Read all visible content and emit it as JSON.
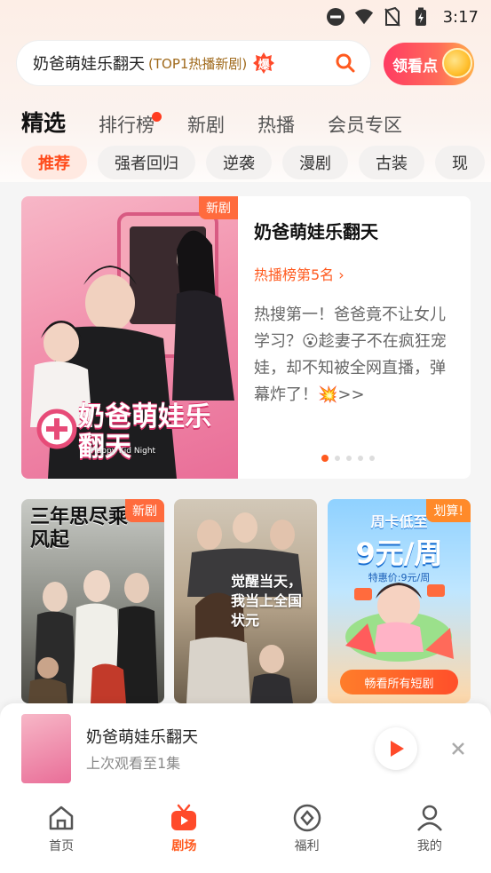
{
  "status_bar": {
    "time": "3:17"
  },
  "search": {
    "query": "奶爸萌娃乐翻天",
    "hint": "(TOP1热播新剧)",
    "hot_badge": "爆"
  },
  "reward_button": {
    "label": "领看点"
  },
  "tabs": [
    {
      "label": "精选",
      "active": true
    },
    {
      "label": "排行榜",
      "has_dot": true
    },
    {
      "label": "新剧"
    },
    {
      "label": "热播"
    },
    {
      "label": "会员专区"
    }
  ],
  "chips": [
    "推荐",
    "强者回归",
    "逆袭",
    "漫剧",
    "古装",
    "现"
  ],
  "featured": {
    "tag": "新剧",
    "title": "奶爸萌娃乐翻天",
    "rank": "热播榜第5名 ›",
    "description": "热搜第一！爸爸竟不让女儿学习？😮趁妻子不在疯狂宠娃，却不知被全网直播，弹幕炸了！💥>>",
    "poster_text": "奶爸萌娃乐翻天",
    "poster_subtext": "Happy Kid Night",
    "carousel_count": 5,
    "carousel_index": 0
  },
  "grid": [
    {
      "tag": "新剧",
      "poster_text": "三年思尽乘风起"
    },
    {
      "tag": "",
      "poster_text": "觉醒当天，我当上全国状元"
    },
    {
      "tag": "划算!",
      "promo_title": "周卡低至",
      "promo_price": "9元/周",
      "promo_sub": "特惠价:9元/周",
      "promo_button": "畅看所有短剧"
    }
  ],
  "mini_player": {
    "title": "奶爸萌娃乐翻天",
    "progress_text": "上次观看至1集"
  },
  "bottom_nav": [
    {
      "label": "首页",
      "icon": "home-icon"
    },
    {
      "label": "剧场",
      "icon": "theater-icon",
      "active": true
    },
    {
      "label": "福利",
      "icon": "coin-icon"
    },
    {
      "label": "我的",
      "icon": "profile-icon"
    }
  ],
  "colors": {
    "accent": "#ff5a1f",
    "tag_orange": "#ff6b3d",
    "dot_red": "#ff3b1f"
  }
}
